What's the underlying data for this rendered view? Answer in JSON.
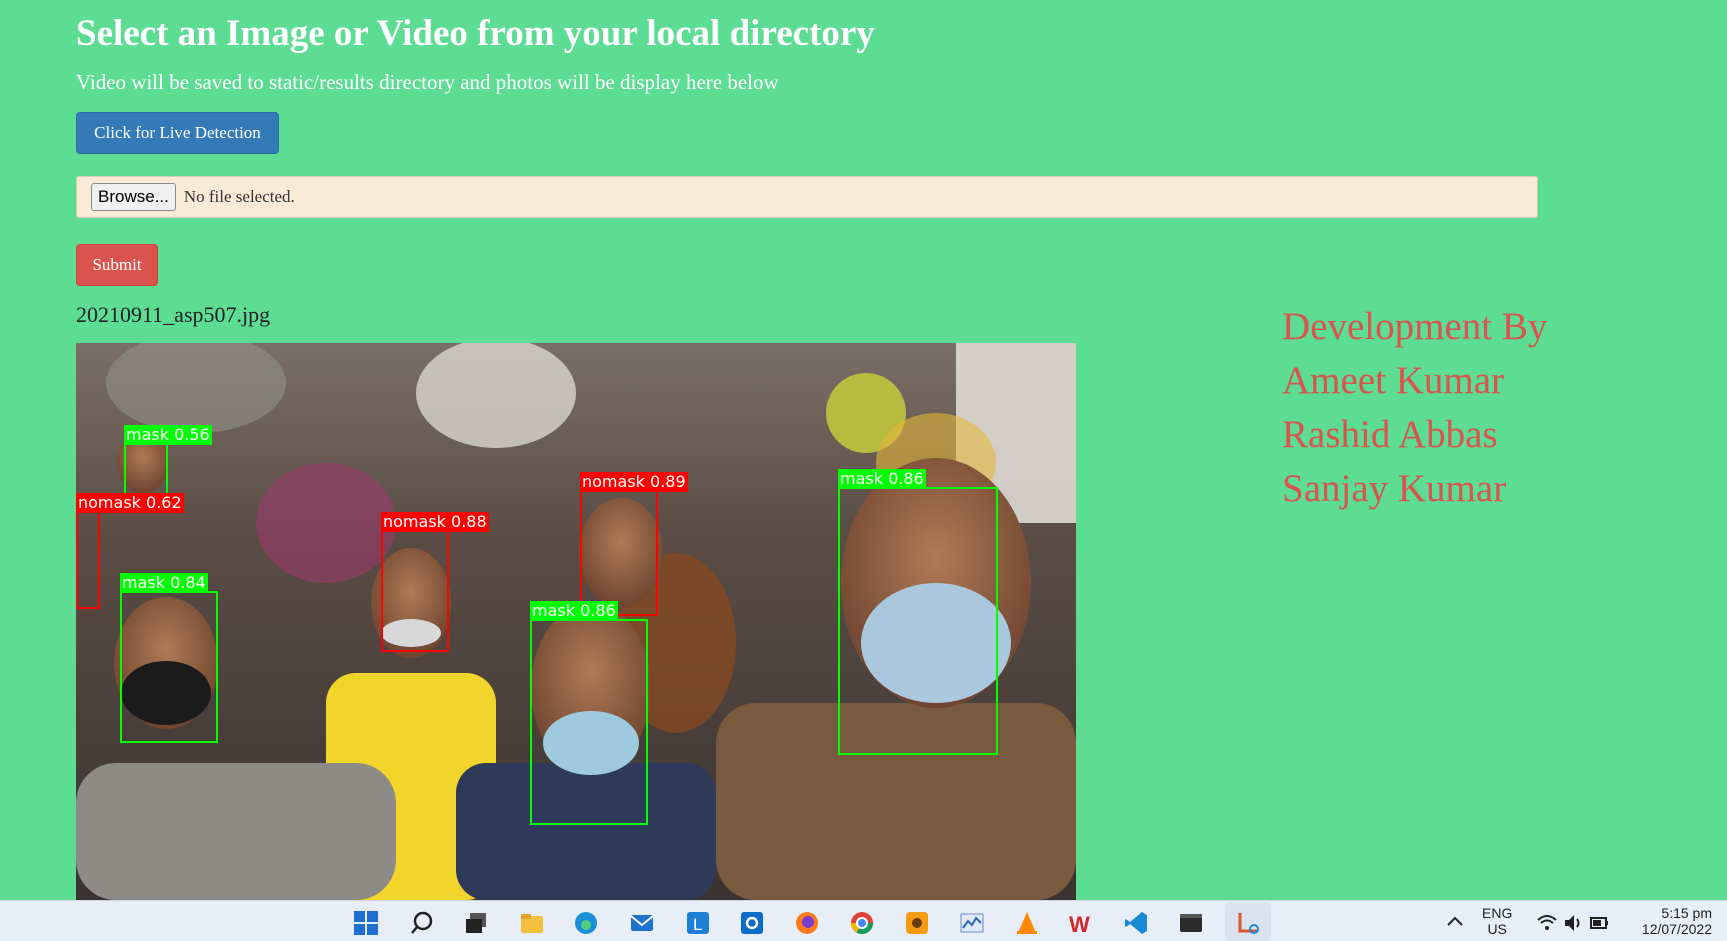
{
  "header": {
    "title": "Select an Image or Video from your local directory",
    "subtitle": "Video will be saved to static/results directory and photos will be display here below"
  },
  "actions": {
    "live_label": "Click for Live Detection",
    "browse_label": "Browse...",
    "file_status": "No file selected.",
    "submit_label": "Submit"
  },
  "result": {
    "filename": "20210911_asp507.jpg",
    "detections": [
      {
        "label": "mask",
        "score": "0.56",
        "class": "mask"
      },
      {
        "label": "nomask",
        "score": "0.62",
        "class": "nomask"
      },
      {
        "label": "nomask",
        "score": "0.88",
        "class": "nomask"
      },
      {
        "label": "nomask",
        "score": "0.89",
        "class": "nomask"
      },
      {
        "label": "mask",
        "score": "0.86",
        "class": "mask"
      },
      {
        "label": "mask",
        "score": "0.84",
        "class": "mask"
      },
      {
        "label": "mask",
        "score": "0.86",
        "class": "mask"
      }
    ]
  },
  "credits": {
    "heading": "Development By",
    "names": [
      "Ameet Kumar",
      "Rashid Abbas",
      "Sanjay Kumar"
    ]
  },
  "taskbar": {
    "icons": [
      "start-icon",
      "search-icon",
      "task-view-icon",
      "file-explorer-icon",
      "edge-icon",
      "mail-icon",
      "l-app-icon",
      "outlook-icon",
      "firefox-icon",
      "chrome-icon",
      "app-orange-icon",
      "chart-app-icon",
      "vlc-icon",
      "wps-icon",
      "vscode-icon",
      "terminal-icon",
      "snipping-tool-icon"
    ],
    "lang": "ENG",
    "region": "US",
    "time": "5:15 pm",
    "date": "12/07/2022"
  },
  "colors": {
    "background": "#5ddc94",
    "primary": "#337ab7",
    "danger": "#d9534f",
    "mask_box": "#00ff00",
    "nomask_box": "#ff0000"
  }
}
